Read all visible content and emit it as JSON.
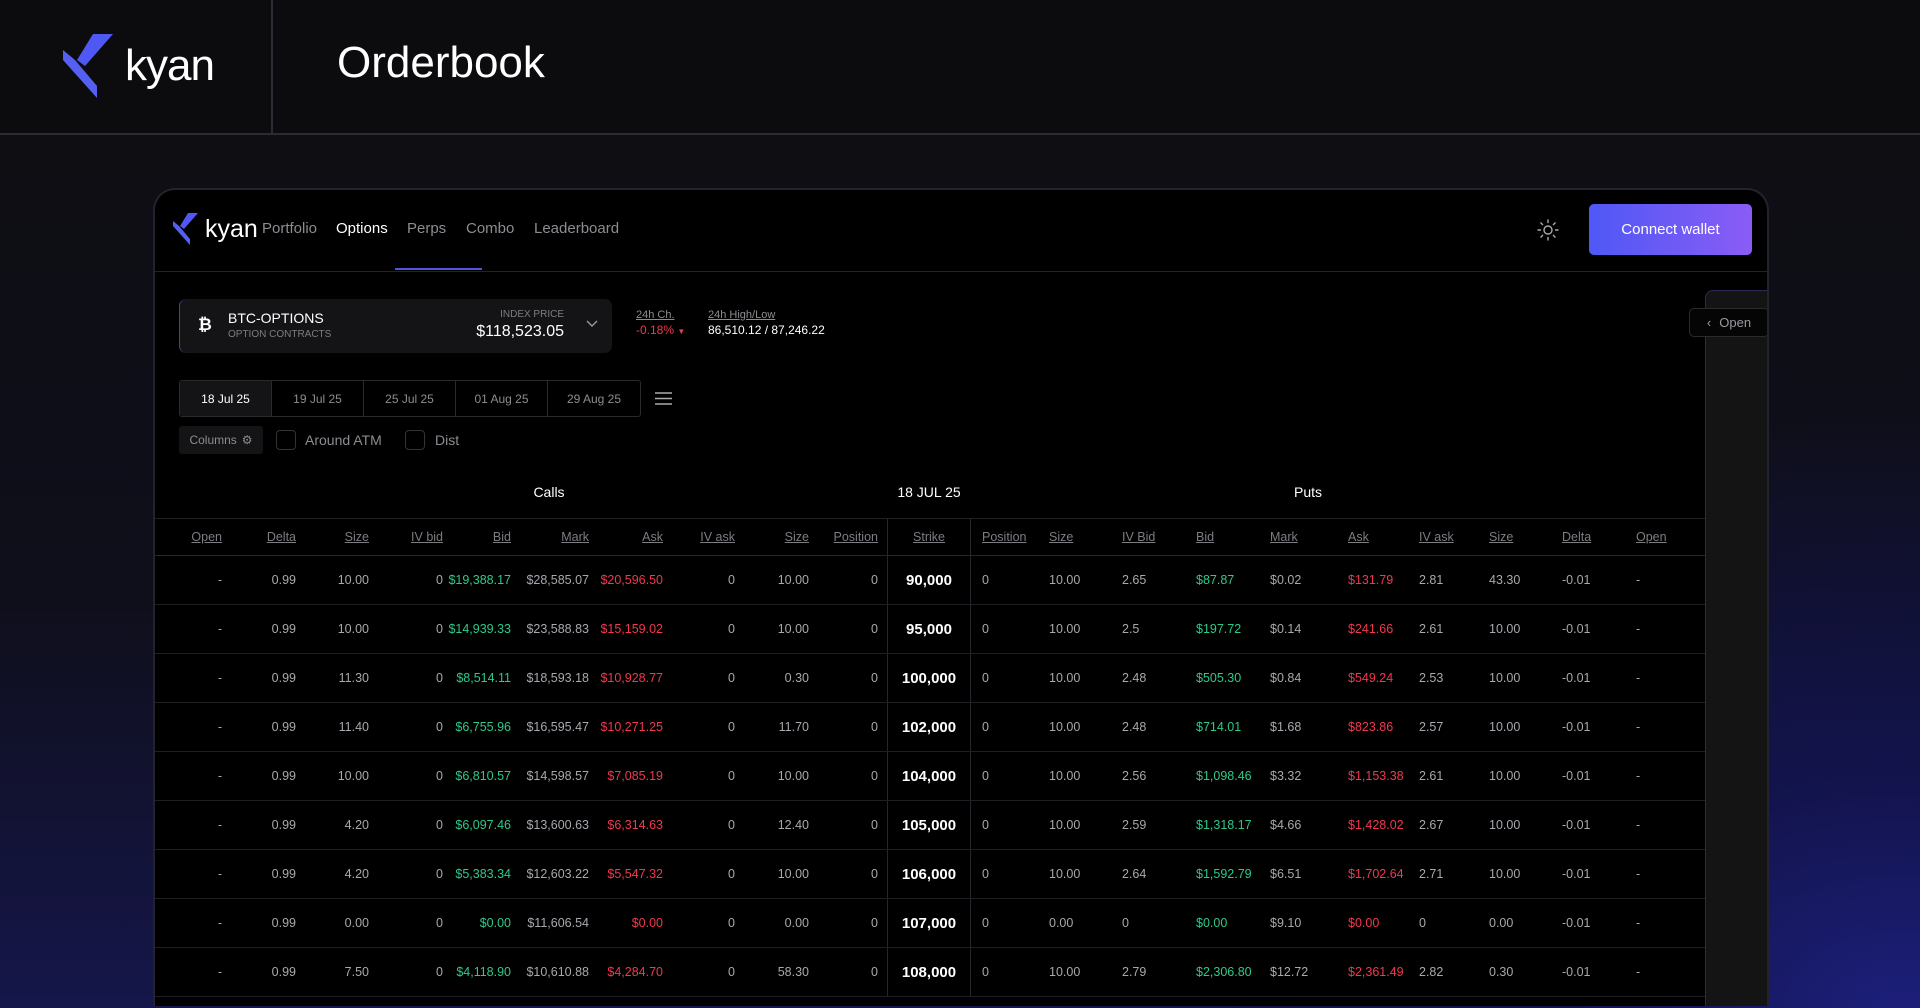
{
  "header": {
    "brand": "kyan",
    "title": "Orderbook"
  },
  "app": {
    "brand": "kyan",
    "nav": [
      {
        "label": "Portfolio",
        "active": false
      },
      {
        "label": "Options",
        "active": true
      },
      {
        "label": "Perps",
        "active": false
      },
      {
        "label": "Combo",
        "active": false
      },
      {
        "label": "Leaderboard",
        "active": false
      }
    ],
    "connect_label": "Connect wallet",
    "open_label": "Open",
    "market": {
      "symbol": "BTC-OPTIONS",
      "subtitle": "OPTION CONTRACTS",
      "index_label": "INDEX PRICE",
      "index_price": "$118,523.05"
    },
    "change": {
      "label": "24h Ch.",
      "value": "-0.18%"
    },
    "highlow": {
      "label": "24h High/Low",
      "value": "86,510.12 / 87,246.22"
    },
    "dates": [
      "18 Jul 25",
      "19 Jul 25",
      "25 Jul 25",
      "01 Aug 25",
      "29 Aug 25"
    ],
    "active_date": 0,
    "columns_label": "Columns",
    "around_atm_label": "Around ATM",
    "dist_label": "Dist",
    "colors": {
      "bid": "#2ec98a",
      "ask": "#f0384f",
      "accent": "#4f58f5"
    }
  },
  "table": {
    "calls_label": "Calls",
    "expiry_label": "18 JUL 25",
    "puts_label": "Puts",
    "call_headers": [
      "Open",
      "Delta",
      "Size",
      "IV bid",
      "Bid",
      "Mark",
      "Ask",
      "IV ask",
      "Size",
      "Position"
    ],
    "strike_header": "Strike",
    "put_headers": [
      "Position",
      "Size",
      "IV Bid",
      "Bid",
      "Mark",
      "Ask",
      "IV ask",
      "Size",
      "Delta",
      "Open"
    ],
    "rows": [
      {
        "calls": [
          "-",
          "0.99",
          "10.00",
          "0",
          "$19,388.17",
          "$28,585.07",
          "$20,596.50",
          "0",
          "10.00",
          "0"
        ],
        "strike": "90,000",
        "puts": [
          "0",
          "10.00",
          "2.65",
          "$87.87",
          "$0.02",
          "$131.79",
          "2.81",
          "43.30",
          "-0.01",
          "-"
        ]
      },
      {
        "calls": [
          "-",
          "0.99",
          "10.00",
          "0",
          "$14,939.33",
          "$23,588.83",
          "$15,159.02",
          "0",
          "10.00",
          "0"
        ],
        "strike": "95,000",
        "puts": [
          "0",
          "10.00",
          "2.5",
          "$197.72",
          "$0.14",
          "$241.66",
          "2.61",
          "10.00",
          "-0.01",
          "-"
        ]
      },
      {
        "calls": [
          "-",
          "0.99",
          "11.30",
          "0",
          "$8,514.11",
          "$18,593.18",
          "$10,928.77",
          "0",
          "0.30",
          "0"
        ],
        "strike": "100,000",
        "puts": [
          "0",
          "10.00",
          "2.48",
          "$505.30",
          "$0.84",
          "$549.24",
          "2.53",
          "10.00",
          "-0.01",
          "-"
        ]
      },
      {
        "calls": [
          "-",
          "0.99",
          "11.40",
          "0",
          "$6,755.96",
          "$16,595.47",
          "$10,271.25",
          "0",
          "11.70",
          "0"
        ],
        "strike": "102,000",
        "puts": [
          "0",
          "10.00",
          "2.48",
          "$714.01",
          "$1.68",
          "$823.86",
          "2.57",
          "10.00",
          "-0.01",
          "-"
        ]
      },
      {
        "calls": [
          "-",
          "0.99",
          "10.00",
          "0",
          "$6,810.57",
          "$14,598.57",
          "$7,085.19",
          "0",
          "10.00",
          "0"
        ],
        "strike": "104,000",
        "puts": [
          "0",
          "10.00",
          "2.56",
          "$1,098.46",
          "$3.32",
          "$1,153.38",
          "2.61",
          "10.00",
          "-0.01",
          "-"
        ]
      },
      {
        "calls": [
          "-",
          "0.99",
          "4.20",
          "0",
          "$6,097.46",
          "$13,600.63",
          "$6,314.63",
          "0",
          "12.40",
          "0"
        ],
        "strike": "105,000",
        "puts": [
          "0",
          "10.00",
          "2.59",
          "$1,318.17",
          "$4.66",
          "$1,428.02",
          "2.67",
          "10.00",
          "-0.01",
          "-"
        ]
      },
      {
        "calls": [
          "-",
          "0.99",
          "4.20",
          "0",
          "$5,383.34",
          "$12,603.22",
          "$5,547.32",
          "0",
          "10.00",
          "0"
        ],
        "strike": "106,000",
        "puts": [
          "0",
          "10.00",
          "2.64",
          "$1,592.79",
          "$6.51",
          "$1,702.64",
          "2.71",
          "10.00",
          "-0.01",
          "-"
        ]
      },
      {
        "calls": [
          "-",
          "0.99",
          "0.00",
          "0",
          "$0.00",
          "$11,606.54",
          "$0.00",
          "0",
          "0.00",
          "0"
        ],
        "strike": "107,000",
        "puts": [
          "0",
          "0.00",
          "0",
          "$0.00",
          "$9.10",
          "$0.00",
          "0",
          "0.00",
          "-0.01",
          "-"
        ]
      },
      {
        "calls": [
          "-",
          "0.99",
          "7.50",
          "0",
          "$4,118.90",
          "$10,610.88",
          "$4,284.70",
          "0",
          "58.30",
          "0"
        ],
        "strike": "108,000",
        "puts": [
          "0",
          "10.00",
          "2.79",
          "$2,306.80",
          "$12.72",
          "$2,361.49",
          "2.82",
          "0.30",
          "-0.01",
          "-"
        ]
      }
    ]
  }
}
